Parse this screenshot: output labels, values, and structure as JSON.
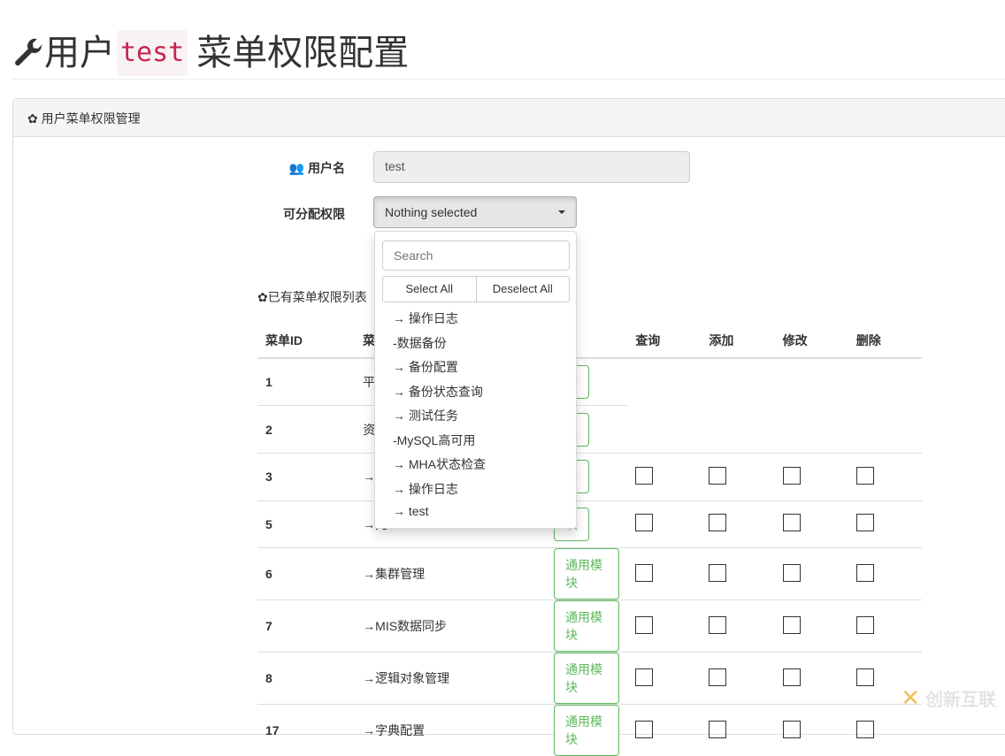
{
  "page": {
    "title_prefix": "用户",
    "title_user": "test",
    "title_suffix": "菜单权限配置"
  },
  "panel": {
    "heading": "用户菜单权限管理"
  },
  "form": {
    "username_label": "用户名",
    "username_value": "test",
    "perm_label": "可分配权限",
    "perm_selected": "Nothing selected"
  },
  "dropdown": {
    "search_placeholder": "Search",
    "select_all": "Select All",
    "deselect_all": "Deselect All",
    "options": [
      "→ 操作日志",
      "-数据备份",
      "→ 备份配置",
      "→ 备份状态查询",
      "→ 测试任务",
      "-MySQL高可用",
      "→ MHA状态检查",
      "→ 操作日志",
      "→ test"
    ]
  },
  "list": {
    "title": "已有菜单权限列表",
    "headers": [
      "菜单ID",
      "菜单",
      "",
      "查询",
      "添加",
      "修改",
      "删除"
    ],
    "rows": [
      {
        "id": "1",
        "name": "平台",
        "module": "块",
        "checks": false
      },
      {
        "id": "2",
        "name": "资产",
        "module": "理",
        "checks": false
      },
      {
        "id": "3",
        "name": "→资",
        "module": "块",
        "checks": true
      },
      {
        "id": "5",
        "name": "→元",
        "module": "块",
        "checks": true
      },
      {
        "id": "6",
        "name": "→集群管理",
        "module": "通用模块",
        "checks": true
      },
      {
        "id": "7",
        "name": "→MIS数据同步",
        "module": "通用模块",
        "checks": true
      },
      {
        "id": "8",
        "name": "→逻辑对象管理",
        "module": "通用模块",
        "checks": true
      },
      {
        "id": "17",
        "name": "→字典配置",
        "module": "通用模块",
        "checks": true
      }
    ]
  },
  "watermark": "创新互联",
  "colors": {
    "code": "#c7254e",
    "success": "#5cb85c"
  }
}
